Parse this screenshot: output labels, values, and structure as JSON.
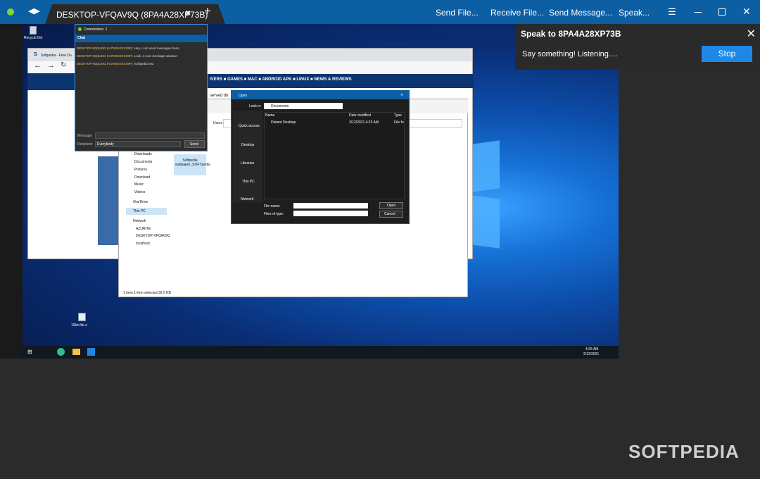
{
  "app": {
    "tab_title": "DESKTOP-VFQAV9Q (8PA4A28XP73B)",
    "tab_close": "✖",
    "new_tab": "+",
    "menu": [
      "Send File...",
      "Receive File...",
      "Send Message...",
      "Speak..."
    ],
    "status_color": "#7cd33a",
    "accent": "#0d5fa3"
  },
  "speak_panel": {
    "title": "Speak to 8PA4A28XP73B",
    "message": "Say something! Listening....",
    "stop_label": "Stop",
    "close": "✕"
  },
  "remote": {
    "desktop_icon_label": "Recycle Bin",
    "chat": {
      "connections": "Connections: 1",
      "title": "Chat",
      "lines": [
        {
          "name": "DESKTOP-8Q3L593 (A37KBV3XX29P):",
          "text": " Hey, I can send messages here!"
        },
        {
          "name": "DESKTOP-8Q3L593 (A37KBV3XX29P):",
          "text": " Look, a new message window!"
        },
        {
          "name": "DESKTOP-8Q3L593 (A37KBV3XX29P):",
          "text": " Softpedia test"
        }
      ],
      "message_label": "Message:",
      "recipient_label": "Recipient:",
      "recipient_value": "Everybody",
      "send_label": "Send"
    },
    "browser": {
      "tab": "Softpedia - Free Do",
      "nav_items": "IVERS  ■ GAMES  ■ MAC  ■ ANDROID APK  ■ LINUX  ■ NEWS & REVIEWS",
      "served": "served do"
    },
    "explorer": {
      "breadcrumb": "Users",
      "sidebar": [
        "Downloads",
        "Documents",
        "Pictures",
        "Download",
        "Music",
        "Videos",
        "OneDrive",
        "This PC",
        "Network",
        "AZURITE",
        "DESKTOP-VFQAV9Q",
        "localhost"
      ],
      "file_label": "Softpedia wallpaper_SOFTpedia",
      "status": "1 item     1 item selected  32.0 KB"
    },
    "open_dialog": {
      "title": "Open",
      "look_in_label": "Look in:",
      "look_in_value": "Documents",
      "places": [
        "Quick access",
        "Desktop",
        "Libraries",
        "This PC",
        "Network"
      ],
      "columns": [
        "Name",
        "Date modified",
        "Type"
      ],
      "rows": [
        {
          "name": "Distant Desktop",
          "date": "2/12/2021 4:23 AM",
          "type": "File fo"
        }
      ],
      "file_name_label": "File name:",
      "file_type_label": "Files of type:",
      "open_label": "Open",
      "cancel_label": "Cancel"
    },
    "taskbar": {
      "time": "4:25 AM",
      "date": "2/12/2021"
    },
    "desktop_file_label": "10kb.file-s"
  },
  "watermark": "SOFTPEDIA"
}
